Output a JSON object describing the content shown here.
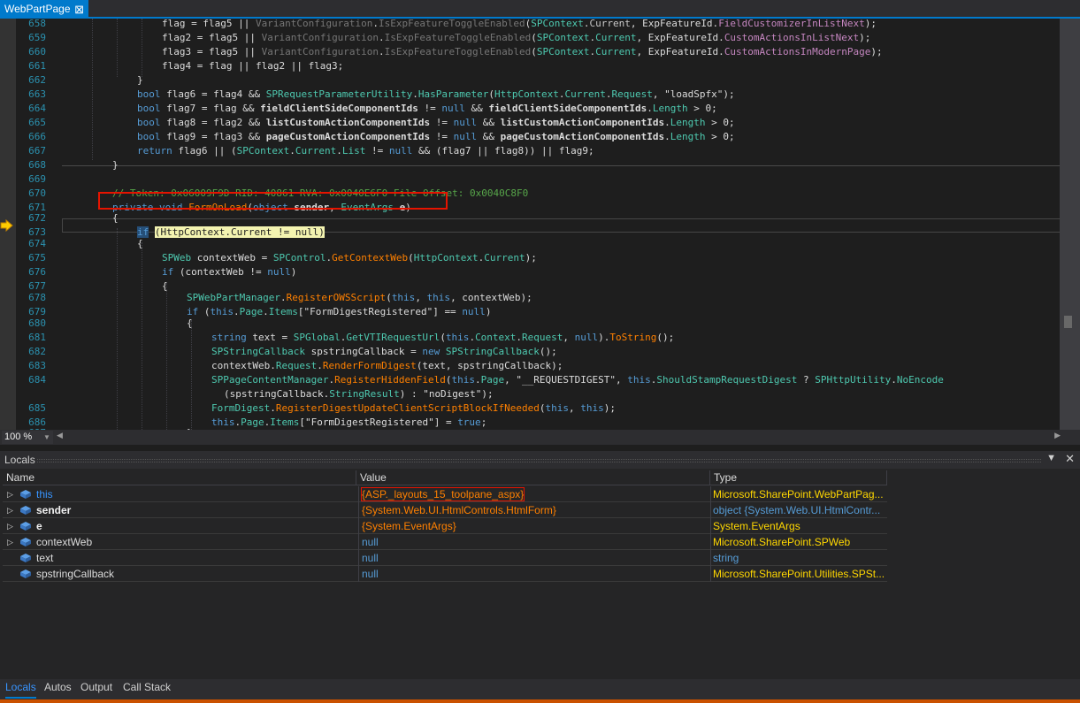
{
  "document_tab": {
    "title": "WebPartPage",
    "pin_glyph": "⊠"
  },
  "code_lines": [
    {
      "n": "658",
      "t": "flag = flag5 || VariantConfiguration.IsExpFeatureToggleEnabled(SPContext.Current, ExpFeatureId.FieldCustomizerInListNext);"
    },
    {
      "n": "659",
      "t": "flag2 = flag5 || VariantConfiguration.IsExpFeatureToggleEnabled(SPContext.Current, ExpFeatureId.CustomActionsInListNext);"
    },
    {
      "n": "660",
      "t": "flag3 = flag5 || VariantConfiguration.IsExpFeatureToggleEnabled(SPContext.Current, ExpFeatureId.CustomActionsInModernPage);"
    },
    {
      "n": "661",
      "t": "flag4 = flag || flag2 || flag3;"
    },
    {
      "n": "662",
      "t": "}"
    },
    {
      "n": "663",
      "t": "bool flag6 = flag4 && SPRequestParameterUtility.HasParameter(HttpContext.Current.Request, \"loadSpfx\");"
    },
    {
      "n": "664",
      "t": "bool flag7 = flag && fieldClientSideComponentIds != null && fieldClientSideComponentIds.Length > 0;"
    },
    {
      "n": "665",
      "t": "bool flag8 = flag2 && listCustomActionComponentIds != null && listCustomActionComponentIds.Length > 0;"
    },
    {
      "n": "666",
      "t": "bool flag9 = flag3 && pageCustomActionComponentIds != null && pageCustomActionComponentIds.Length > 0;"
    },
    {
      "n": "667",
      "t": "return flag6 || (SPContext.Current.List != null && (flag7 || flag8)) || flag9;"
    },
    {
      "n": "668",
      "t": "}"
    },
    {
      "n": "669",
      "t": ""
    },
    {
      "n": "670",
      "t": "// Token: 0x06009F9D RID: 40861 RVA: 0x0040E6F0 File Offset: 0x0040C8F0"
    },
    {
      "n": "671",
      "t": "private void FormOnLoad(object sender, EventArgs e)"
    },
    {
      "n": "672",
      "t": "{"
    },
    {
      "n": "673",
      "t": "if (HttpContext.Current != null)"
    },
    {
      "n": "674",
      "t": "{"
    },
    {
      "n": "675",
      "t": "SPWeb contextWeb = SPControl.GetContextWeb(HttpContext.Current);"
    },
    {
      "n": "676",
      "t": "if (contextWeb != null)"
    },
    {
      "n": "677",
      "t": "{"
    },
    {
      "n": "678",
      "t": "SPWebPartManager.RegisterOWSScript(this, this, contextWeb);"
    },
    {
      "n": "679",
      "t": "if (this.Page.Items[\"FormDigestRegistered\"] == null)"
    },
    {
      "n": "680",
      "t": "{"
    },
    {
      "n": "681",
      "t": "string text = SPGlobal.GetVTIRequestUrl(this.Context.Request, null).ToString();"
    },
    {
      "n": "682",
      "t": "SPStringCallback spstringCallback = new SPStringCallback();"
    },
    {
      "n": "683",
      "t": "contextWeb.Request.RenderFormDigest(text, spstringCallback);"
    },
    {
      "n": "684",
      "t": "SPPageContentManager.RegisterHiddenField(this.Page, \"__REQUESTDIGEST\", this.ShouldStampRequestDigest ? SPHttpUtility.NoEncode"
    },
    {
      "n": "",
      "t": "(spstringCallback.StringResult) : \"noDigest\");"
    },
    {
      "n": "685",
      "t": "FormDigest.RegisterDigestUpdateClientScriptBlockIfNeeded(this, this);"
    },
    {
      "n": "686",
      "t": "this.Page.Items[\"FormDigestRegistered\"] = true;"
    },
    {
      "n": "687",
      "t": "}"
    }
  ],
  "editor_status": {
    "zoom": "100 %"
  },
  "locals": {
    "title": "Locals",
    "columns": {
      "name": "Name",
      "value": "Value",
      "type": "Type"
    },
    "rows": [
      {
        "name": "this",
        "value": "{ASP._layouts_15_toolpane_aspx}",
        "type": "Microsoft.SharePoint.WebPartPag..."
      },
      {
        "name": "sender",
        "value": "{System.Web.UI.HtmlControls.HtmlForm}",
        "type": "object {System.Web.UI.HtmlContr..."
      },
      {
        "name": "e",
        "value": "{System.EventArgs}",
        "type": "System.EventArgs"
      },
      {
        "name": "contextWeb",
        "value": "null",
        "type": "Microsoft.SharePoint.SPWeb"
      },
      {
        "name": "text",
        "value": "null",
        "type": "string"
      },
      {
        "name": "spstringCallback",
        "value": "null",
        "type": "Microsoft.SharePoint.Utilities.SPSt..."
      }
    ]
  },
  "bottom_tabs": [
    "Locals",
    "Autos",
    "Output",
    "Call Stack"
  ],
  "colors": {
    "accent": "#007acc",
    "editor_background": "#1e1e1e",
    "keyword": "#569cd6",
    "type": "#4ec9b0",
    "method": "#ff8000",
    "comment": "#57a64a",
    "highlight_box": "#e51400",
    "current_statement": "#f3f3b0"
  },
  "icons": {
    "breakpoint_arrow": "current-statement-arrow-icon",
    "local_variable": "local-variable-icon",
    "expand": "expand-arrow-icon",
    "close": "close-icon",
    "dropdown": "chevron-down-icon"
  }
}
